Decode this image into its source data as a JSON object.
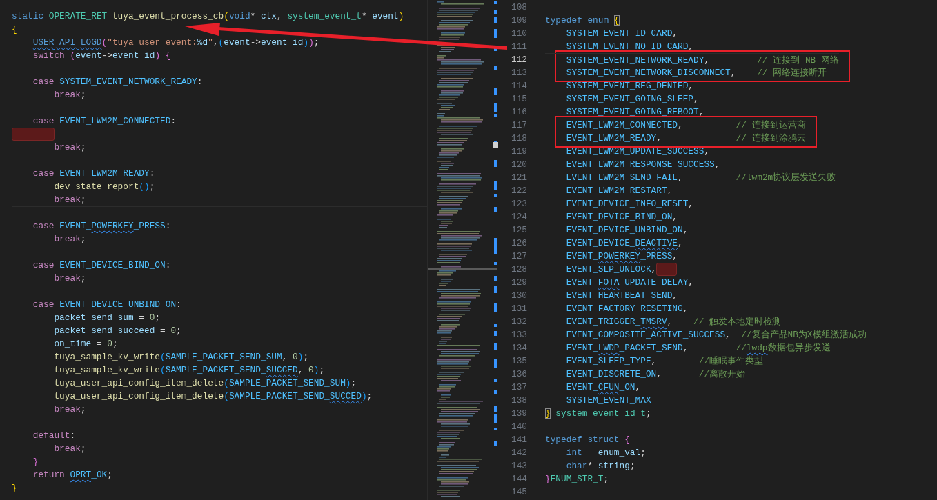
{
  "arrow_annotation": true,
  "left_code": [
    {
      "t": [
        {
          "text": "static ",
          "kind": "kw"
        },
        {
          "text": "OPERATE_RET ",
          "kind": "type"
        },
        {
          "text": "tuya_event_process_cb",
          "kind": "fn"
        },
        {
          "text": "(",
          "kind": "b1"
        },
        {
          "text": "void",
          "kind": "kw"
        },
        {
          "text": "* "
        },
        {
          "text": "ctx",
          "kind": "var"
        },
        {
          "text": ", "
        },
        {
          "text": "system_event_t",
          "kind": "type"
        },
        {
          "text": "* "
        },
        {
          "text": "event",
          "kind": "var"
        },
        {
          "text": ")",
          "kind": "b1"
        }
      ]
    },
    {
      "t": [
        {
          "text": "{",
          "kind": "b1"
        }
      ]
    },
    {
      "t": [
        {
          "text": "    USER_API_LOGD",
          "kind": "macro",
          "squiggle": true
        },
        {
          "text": "(",
          "kind": "b2"
        },
        {
          "text": "\"tuya user event:",
          "kind": "str"
        },
        {
          "text": "%d",
          "kind": "var"
        },
        {
          "text": "\"",
          "kind": "str"
        },
        {
          "text": ","
        },
        {
          "text": "(",
          "kind": "b3"
        },
        {
          "text": "event",
          "kind": "var"
        },
        {
          "text": "->"
        },
        {
          "text": "event_id",
          "kind": "var"
        },
        {
          "text": ")",
          "kind": "b3"
        },
        {
          "text": ")",
          "kind": "b2"
        },
        {
          "text": ";"
        }
      ]
    },
    {
      "t": [
        {
          "text": "    switch ",
          "kind": "ctl"
        },
        {
          "text": "(",
          "kind": "b2"
        },
        {
          "text": "event",
          "kind": "var"
        },
        {
          "text": "->"
        },
        {
          "text": "event_id",
          "kind": "var"
        },
        {
          "text": ") ",
          "kind": "b2"
        },
        {
          "text": "{",
          "kind": "b2"
        }
      ]
    },
    {
      "space_before": true,
      "t": [
        {
          "text": "    case ",
          "kind": "ctl"
        },
        {
          "text": "SYSTEM_EVENT_NETWORK_READY",
          "kind": "const"
        },
        {
          "text": ":"
        }
      ]
    },
    {
      "t": [
        {
          "text": "        break",
          "kind": "ctl"
        },
        {
          "text": ";"
        }
      ]
    },
    {
      "space_before": true,
      "t": [
        {
          "text": "    case ",
          "kind": "ctl"
        },
        {
          "text": "EVENT_LWM2M_CONNECTED",
          "kind": "const"
        },
        {
          "text": ":"
        }
      ]
    },
    {
      "err": true
    },
    {
      "t": [
        {
          "text": "        break",
          "kind": "ctl"
        },
        {
          "text": ";"
        }
      ]
    },
    {
      "space_before": true,
      "t": [
        {
          "text": "    case ",
          "kind": "ctl"
        },
        {
          "text": "EVENT_LWM2M_READY",
          "kind": "const"
        },
        {
          "text": ":"
        }
      ]
    },
    {
      "t": [
        {
          "text": "        dev_state_report",
          "kind": "fn"
        },
        {
          "text": "(",
          "kind": "b3"
        },
        {
          "text": ")",
          "kind": "b3"
        },
        {
          "text": ";"
        }
      ]
    },
    {
      "t": [
        {
          "text": "        break",
          "kind": "ctl"
        },
        {
          "text": ";"
        }
      ]
    },
    {
      "current": true
    },
    {
      "t": [
        {
          "text": "    case ",
          "kind": "ctl"
        },
        {
          "text": "EVENT_",
          "kind": "const"
        },
        {
          "text": "POWERKEY",
          "kind": "const",
          "squiggle": true
        },
        {
          "text": "_PRESS",
          "kind": "const"
        },
        {
          "text": ":"
        }
      ]
    },
    {
      "t": [
        {
          "text": "        break",
          "kind": "ctl"
        },
        {
          "text": ";"
        }
      ]
    },
    {
      "space_before": true,
      "t": [
        {
          "text": "    case ",
          "kind": "ctl"
        },
        {
          "text": "EVENT_DEVICE_BIND_ON",
          "kind": "const"
        },
        {
          "text": ":"
        }
      ]
    },
    {
      "t": [
        {
          "text": "        break",
          "kind": "ctl"
        },
        {
          "text": ";"
        }
      ]
    },
    {
      "space_before": true,
      "t": [
        {
          "text": "    case ",
          "kind": "ctl"
        },
        {
          "text": "EVENT_DEVICE_UNBIND_ON",
          "kind": "const"
        },
        {
          "text": ":"
        }
      ]
    },
    {
      "t": [
        {
          "text": "        packet_send_sum",
          "kind": "var"
        },
        {
          "text": " = "
        },
        {
          "text": "0",
          "kind": "num"
        },
        {
          "text": ";"
        }
      ]
    },
    {
      "t": [
        {
          "text": "        packet_send_succeed",
          "kind": "var"
        },
        {
          "text": " = "
        },
        {
          "text": "0",
          "kind": "num"
        },
        {
          "text": ";"
        }
      ]
    },
    {
      "t": [
        {
          "text": "        on_time",
          "kind": "var"
        },
        {
          "text": " = "
        },
        {
          "text": "0",
          "kind": "num"
        },
        {
          "text": ";"
        }
      ]
    },
    {
      "t": [
        {
          "text": "        tuya_sample_kv_write",
          "kind": "fn"
        },
        {
          "text": "(",
          "kind": "b3"
        },
        {
          "text": "SAMPLE_PACKET_SEND_SUM",
          "kind": "const"
        },
        {
          "text": ", "
        },
        {
          "text": "0",
          "kind": "num"
        },
        {
          "text": ")",
          "kind": "b3"
        },
        {
          "text": ";"
        }
      ]
    },
    {
      "t": [
        {
          "text": "        tuya_sample_kv_write",
          "kind": "fn"
        },
        {
          "text": "(",
          "kind": "b3"
        },
        {
          "text": "SAMPLE_PACKET_SEND_",
          "kind": "const"
        },
        {
          "text": "SUCCED",
          "kind": "const",
          "squiggle": true
        },
        {
          "text": ", "
        },
        {
          "text": "0",
          "kind": "num"
        },
        {
          "text": ")",
          "kind": "b3"
        },
        {
          "text": ";"
        }
      ]
    },
    {
      "t": [
        {
          "text": "        tuya_user_api_config_item_delete",
          "kind": "fn"
        },
        {
          "text": "(",
          "kind": "b3"
        },
        {
          "text": "SAMPLE_PACKET_SEND_SUM",
          "kind": "const"
        },
        {
          "text": ")",
          "kind": "b3"
        },
        {
          "text": ";"
        }
      ]
    },
    {
      "t": [
        {
          "text": "        tuya_user_api_config_item_delete",
          "kind": "fn"
        },
        {
          "text": "(",
          "kind": "b3"
        },
        {
          "text": "SAMPLE_PACKET_SEND_",
          "kind": "const"
        },
        {
          "text": "SUCCED",
          "kind": "const",
          "squiggle": true
        },
        {
          "text": ")",
          "kind": "b3"
        },
        {
          "text": ";"
        }
      ]
    },
    {
      "t": [
        {
          "text": "        break",
          "kind": "ctl"
        },
        {
          "text": ";"
        }
      ]
    },
    {
      "space_before": true,
      "t": [
        {
          "text": "    default",
          "kind": "ctl"
        },
        {
          "text": ":"
        }
      ]
    },
    {
      "t": [
        {
          "text": "        break",
          "kind": "ctl"
        },
        {
          "text": ";"
        }
      ]
    },
    {
      "t": [
        {
          "text": "    }",
          "kind": "b2"
        }
      ]
    },
    {
      "t": [
        {
          "text": "    return ",
          "kind": "ctl"
        },
        {
          "text": "OPRT",
          "kind": "const",
          "squiggle": true
        },
        {
          "text": "_OK",
          "kind": "const"
        },
        {
          "text": ";"
        }
      ]
    },
    {
      "t": [
        {
          "text": "}",
          "kind": "b1"
        }
      ]
    }
  ],
  "right_code": [
    {
      "n": "108"
    },
    {
      "n": "109",
      "t": [
        {
          "text": "typedef ",
          "kind": "kw"
        },
        {
          "text": "enum ",
          "kind": "kw"
        },
        {
          "text": "{",
          "kind": "match"
        }
      ]
    },
    {
      "n": "110",
      "t": [
        {
          "text": "    SYSTEM_EVENT_ID_CARD",
          "kind": "const"
        },
        {
          "text": ","
        }
      ]
    },
    {
      "n": "111",
      "t": [
        {
          "text": "    SYSTEM_EVENT_NO_ID_CARD",
          "kind": "const"
        },
        {
          "text": ","
        }
      ]
    },
    {
      "n": "112",
      "current": true,
      "boxed": true,
      "t": [
        {
          "text": "    SYSTEM_EVENT_NETWORK_READY",
          "kind": "const"
        },
        {
          "text": ",         "
        },
        {
          "text": "// 连接到 NB 网络",
          "kind": "com"
        }
      ]
    },
    {
      "n": "113",
      "boxed": true,
      "t": [
        {
          "text": "    SYSTEM_EVENT_NETWORK_DISCONNECT",
          "kind": "const"
        },
        {
          "text": ",    "
        },
        {
          "text": "// 网络连接断开",
          "kind": "com"
        }
      ]
    },
    {
      "n": "114",
      "t": [
        {
          "text": "    SYSTEM_EVENT_REG_DENIED",
          "kind": "const"
        },
        {
          "text": ","
        }
      ]
    },
    {
      "n": "115",
      "t": [
        {
          "text": "    SYSTEM_EVENT_GOING_SLEEP",
          "kind": "const"
        },
        {
          "text": ","
        }
      ]
    },
    {
      "n": "116",
      "t": [
        {
          "text": "    SYSTEM_EVENT_GOING_REBOOT",
          "kind": "const"
        },
        {
          "text": ","
        }
      ]
    },
    {
      "n": "117",
      "boxed": true,
      "t": [
        {
          "text": "    EVENT_LWM2M_CONNECTED",
          "kind": "const"
        },
        {
          "text": ",          "
        },
        {
          "text": "// 连接到运营商",
          "kind": "com"
        }
      ]
    },
    {
      "n": "118",
      "boxed": true,
      "t": [
        {
          "text": "    EVENT_LWM2M_READY",
          "kind": "const"
        },
        {
          "text": ",              "
        },
        {
          "text": "// 连接到涂鸦云",
          "kind": "com"
        }
      ]
    },
    {
      "n": "119",
      "t": [
        {
          "text": "    EVENT_LWM2M_UPDATE_SUCCESS",
          "kind": "const"
        },
        {
          "text": ","
        }
      ]
    },
    {
      "n": "120",
      "t": [
        {
          "text": "    EVENT_LWM2M_RESPONSE_SUCCESS",
          "kind": "const"
        },
        {
          "text": ","
        }
      ]
    },
    {
      "n": "121",
      "t": [
        {
          "text": "    EVENT_LWM2M_SEND_FAIL",
          "kind": "const"
        },
        {
          "text": ",          "
        },
        {
          "text": "//lwm2m协议层发送失败",
          "kind": "com"
        }
      ]
    },
    {
      "n": "122",
      "t": [
        {
          "text": "    EVENT_LWM2M_RESTART",
          "kind": "const"
        },
        {
          "text": ","
        }
      ]
    },
    {
      "n": "123",
      "t": [
        {
          "text": "    EVENT_DEVICE_INFO_RESET",
          "kind": "const"
        },
        {
          "text": ","
        }
      ]
    },
    {
      "n": "124",
      "t": [
        {
          "text": "    EVENT_DEVICE_BIND_ON",
          "kind": "const"
        },
        {
          "text": ","
        }
      ]
    },
    {
      "n": "125",
      "t": [
        {
          "text": "    EVENT_DEVICE_UNBIND_ON",
          "kind": "const"
        },
        {
          "text": ","
        }
      ]
    },
    {
      "n": "126",
      "t": [
        {
          "text": "    EVENT_DEVICE_",
          "kind": "const"
        },
        {
          "text": "DEACTIVE",
          "kind": "const",
          "squiggle": true
        },
        {
          "text": ","
        }
      ]
    },
    {
      "n": "127",
      "t": [
        {
          "text": "    EVENT_",
          "kind": "const"
        },
        {
          "text": "POWERKEY",
          "kind": "const",
          "squiggle": true
        },
        {
          "text": "_PRESS",
          "kind": "const"
        },
        {
          "text": ","
        }
      ]
    },
    {
      "n": "128",
      "err": true,
      "t": [
        {
          "text": "    EVENT_SLP_UNLOCK",
          "kind": "const"
        },
        {
          "text": ","
        }
      ]
    },
    {
      "n": "129",
      "t": [
        {
          "text": "    EVENT_",
          "kind": "const"
        },
        {
          "text": "FOTA",
          "kind": "const",
          "squiggle": true
        },
        {
          "text": "_UPDATE_DELAY",
          "kind": "const"
        },
        {
          "text": ","
        }
      ]
    },
    {
      "n": "130",
      "t": [
        {
          "text": "    EVENT_HEARTBEAT_SEND",
          "kind": "const"
        },
        {
          "text": ","
        }
      ]
    },
    {
      "n": "131",
      "t": [
        {
          "text": "    EVENT_FACTORY_RESETING",
          "kind": "const"
        },
        {
          "text": ","
        }
      ]
    },
    {
      "n": "132",
      "t": [
        {
          "text": "    EVENT_TRIGGER_",
          "kind": "const"
        },
        {
          "text": "TMSRV",
          "kind": "const",
          "squiggle": true
        },
        {
          "text": ",    "
        },
        {
          "text": "// 触发本地定时检测",
          "kind": "com"
        }
      ]
    },
    {
      "n": "133",
      "t": [
        {
          "text": "    EVENT_COMPOSITE_ACTIVE_SUCCESS",
          "kind": "const"
        },
        {
          "text": ",  "
        },
        {
          "text": "//复合产品NB为X模组激活成功",
          "kind": "com"
        }
      ]
    },
    {
      "n": "134",
      "t": [
        {
          "text": "    EVENT_",
          "kind": "const"
        },
        {
          "text": "LWDP",
          "kind": "const",
          "squiggle": true
        },
        {
          "text": "_PACKET_SEND",
          "kind": "const"
        },
        {
          "text": ",         "
        },
        {
          "text": "//",
          "kind": "com"
        },
        {
          "text": "lwdp",
          "kind": "com",
          "squiggle": true
        },
        {
          "text": "数据包异步发送",
          "kind": "com"
        }
      ]
    },
    {
      "n": "135",
      "t": [
        {
          "text": "    EVENT_SLEEP_TYPE",
          "kind": "const"
        },
        {
          "text": ",        "
        },
        {
          "text": "//睡眠事件类型",
          "kind": "com"
        }
      ]
    },
    {
      "n": "136",
      "t": [
        {
          "text": "    EVENT_DISCRETE_ON",
          "kind": "const"
        },
        {
          "text": ",       "
        },
        {
          "text": "//离散开始",
          "kind": "com"
        }
      ]
    },
    {
      "n": "137",
      "t": [
        {
          "text": "    EVENT_",
          "kind": "const"
        },
        {
          "text": "CFUN",
          "kind": "const",
          "squiggle": true
        },
        {
          "text": "_ON",
          "kind": "const"
        },
        {
          "text": ","
        }
      ]
    },
    {
      "n": "138",
      "t": [
        {
          "text": "    SYSTEM_EVENT_MAX",
          "kind": "const"
        }
      ]
    },
    {
      "n": "139",
      "t": [
        {
          "text": "}",
          "kind": "match"
        },
        {
          "text": " system_event_id_t",
          "kind": "type"
        },
        {
          "text": ";"
        }
      ]
    },
    {
      "n": "140"
    },
    {
      "n": "141",
      "t": [
        {
          "text": "typedef ",
          "kind": "kw"
        },
        {
          "text": "struct ",
          "kind": "kw"
        },
        {
          "text": "{",
          "kind": "b2"
        }
      ]
    },
    {
      "n": "142",
      "t": [
        {
          "text": "    int   ",
          "kind": "kw"
        },
        {
          "text": "enum_val",
          "kind": "var"
        },
        {
          "text": ";"
        }
      ]
    },
    {
      "n": "143",
      "t": [
        {
          "text": "    char",
          "kind": "kw"
        },
        {
          "text": "* "
        },
        {
          "text": "string",
          "kind": "var"
        },
        {
          "text": ";"
        }
      ]
    },
    {
      "n": "144",
      "t": [
        {
          "text": "}",
          "kind": "b2"
        },
        {
          "text": "ENUM_STR_T",
          "kind": "type"
        },
        {
          "text": ";"
        }
      ]
    },
    {
      "n": "145"
    }
  ]
}
